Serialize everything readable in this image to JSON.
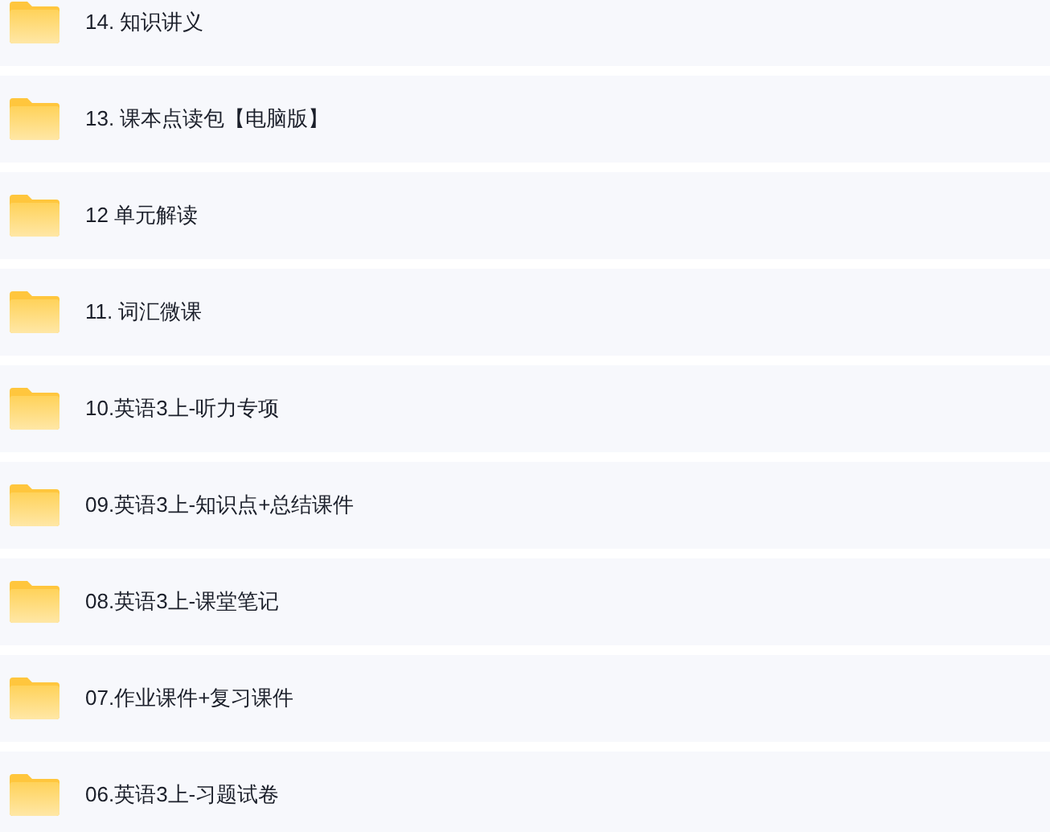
{
  "folders": [
    {
      "name": "14. 知识讲义"
    },
    {
      "name": "13. 课本点读包【电脑版】"
    },
    {
      "name": "12 单元解读"
    },
    {
      "name": "11. 词汇微课"
    },
    {
      "name": "10.英语3上-听力专项"
    },
    {
      "name": "09.英语3上-知识点+总结课件"
    },
    {
      "name": "08.英语3上-课堂笔记"
    },
    {
      "name": "07.作业课件+复习课件"
    },
    {
      "name": "06.英语3上-习题试卷"
    }
  ]
}
